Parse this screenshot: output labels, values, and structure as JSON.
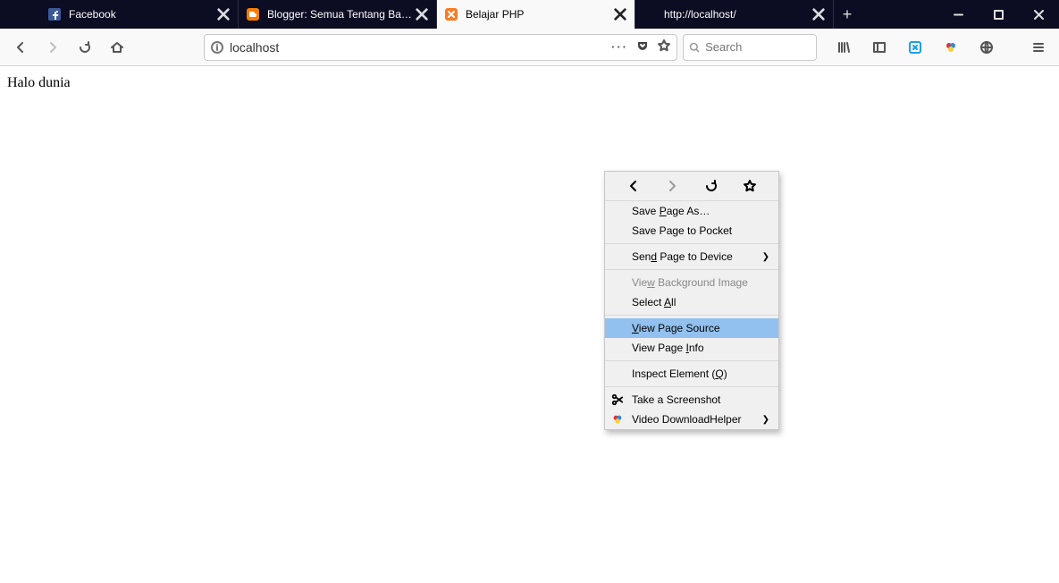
{
  "tabs": [
    {
      "label": "Facebook"
    },
    {
      "label": "Blogger: Semua Tentang Bahasa"
    },
    {
      "label": "Belajar PHP"
    },
    {
      "label": "http://localhost/"
    }
  ],
  "active_tab_index": 2,
  "url": "localhost",
  "search_placeholder": "Search",
  "page_text": "Halo dunia",
  "context_menu": {
    "save_as": "Save Page As…",
    "save_pocket": "Save Page to Pocket",
    "send_device": "Send Page to Device",
    "view_bg": "View Background Image",
    "select_all": "Select All",
    "view_source": "View Page Source",
    "view_info": "View Page Info",
    "inspect": "Inspect Element (Q)",
    "screenshot": "Take a Screenshot",
    "vdh": "Video DownloadHelper"
  }
}
